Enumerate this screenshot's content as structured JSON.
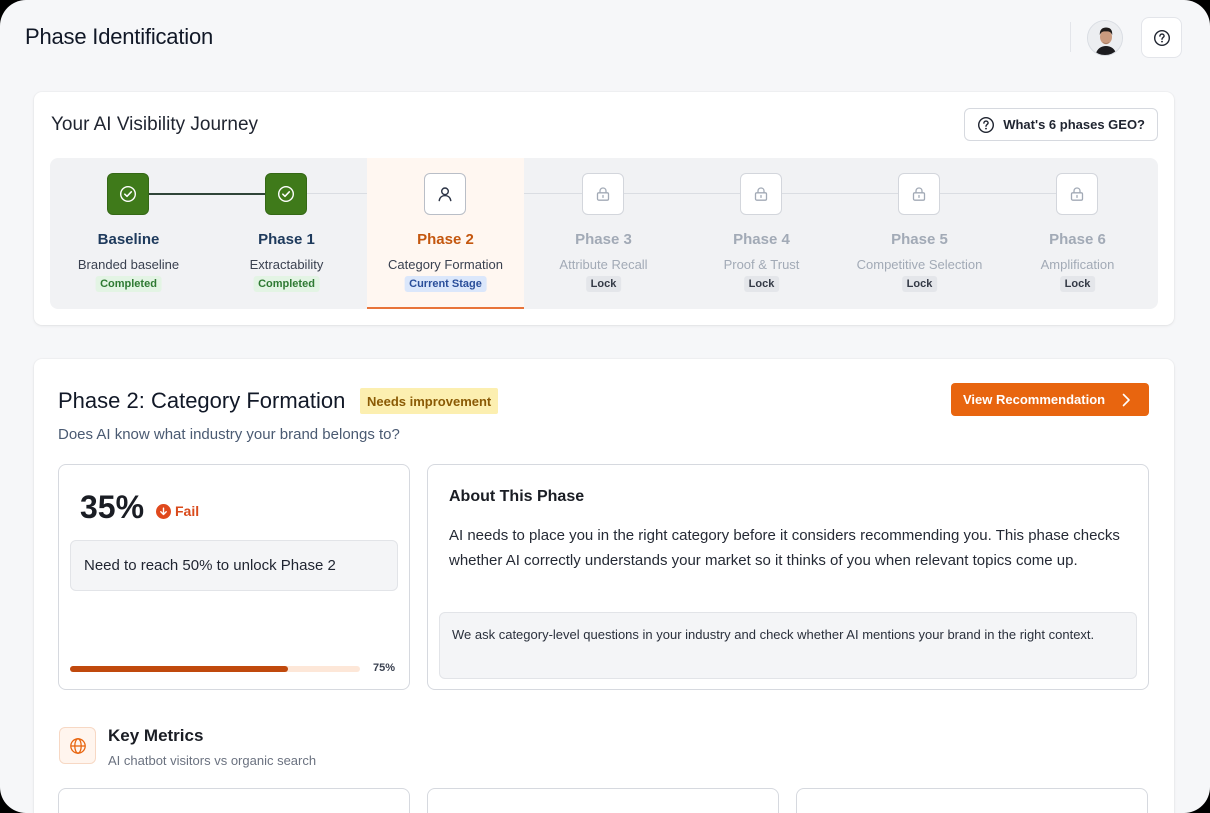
{
  "header": {
    "title": "Phase Identification"
  },
  "journey": {
    "title": "Your AI Visibility Journey",
    "geo_button": "What's 6 phases GEO?",
    "steps": [
      {
        "name": "Baseline",
        "subtitle": "Branded baseline",
        "status": "Completed",
        "state": "done",
        "icon": "check-circle-icon"
      },
      {
        "name": "Phase 1",
        "subtitle": "Extractability",
        "status": "Completed",
        "state": "done",
        "icon": "check-circle-icon"
      },
      {
        "name": "Phase 2",
        "subtitle": "Category Formation",
        "status": "Current Stage",
        "state": "current",
        "icon": "user-icon"
      },
      {
        "name": "Phase 3",
        "subtitle": "Attribute Recall",
        "status": "Lock",
        "state": "locked",
        "icon": "lock-icon"
      },
      {
        "name": "Phase 4",
        "subtitle": "Proof & Trust",
        "status": "Lock",
        "state": "locked",
        "icon": "lock-icon"
      },
      {
        "name": "Phase 5",
        "subtitle": "Competitive Selection",
        "status": "Lock",
        "state": "locked",
        "icon": "lock-icon"
      },
      {
        "name": "Phase 6",
        "subtitle": "Amplification",
        "status": "Lock",
        "state": "locked",
        "icon": "lock-icon"
      }
    ]
  },
  "phase": {
    "title": "Phase 2: Category Formation",
    "badge": "Needs improvement",
    "recommendation_button": "View Recommendation",
    "question": "Does AI know what industry your brand belongs to?",
    "score": {
      "value": "35%",
      "result": "Fail",
      "note": "Need to reach 50% to unlock Phase 2",
      "progress_label": "75%",
      "progress_fraction": 0.75
    },
    "about": {
      "title": "About This Phase",
      "text": "AI needs to place you in the right category before it considers recommending you. This phase checks whether AI correctly understands your market so it thinks of you when relevant topics come up.",
      "note": "We ask category-level questions in your industry and check whether AI mentions your brand in the right context."
    },
    "key_metrics": {
      "title": "Key Metrics",
      "subtitle": "AI chatbot visitors vs organic search"
    }
  },
  "colors": {
    "accent": "#e8650f",
    "done": "#3f7a1a",
    "current_text": "#c4570f"
  }
}
